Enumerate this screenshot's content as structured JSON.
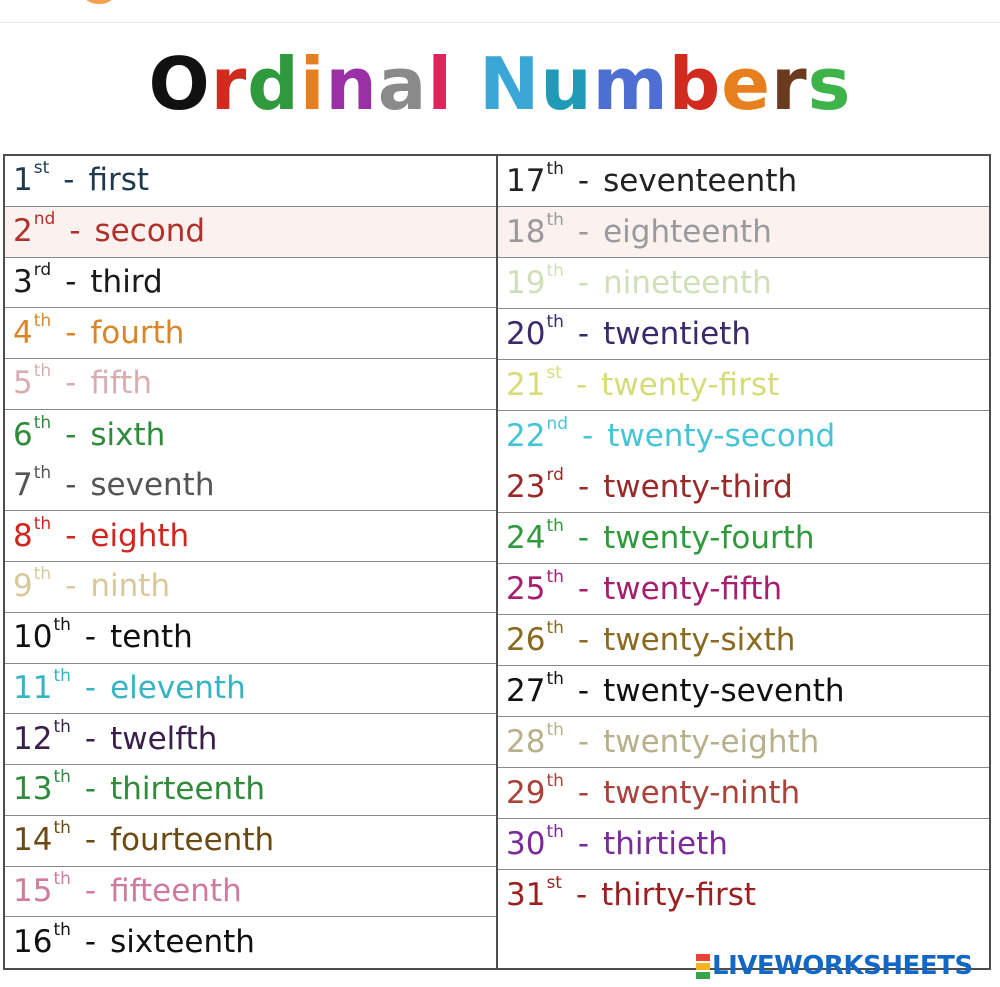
{
  "title": {
    "letters": [
      {
        "char": "O",
        "color": "#111111"
      },
      {
        "char": "r",
        "color": "#d12a1f"
      },
      {
        "char": "d",
        "color": "#2f9a3c"
      },
      {
        "char": "i",
        "color": "#e87f1e"
      },
      {
        "char": "n",
        "color": "#9b2fa6"
      },
      {
        "char": "a",
        "color": "#8a8a8a"
      },
      {
        "char": "l",
        "color": "#e0245e"
      },
      {
        "char": " ",
        "color": "#ffffff"
      },
      {
        "char": "N",
        "color": "#3aa7d6"
      },
      {
        "char": "u",
        "color": "#1f9bb8"
      },
      {
        "char": "m",
        "color": "#4c6fd1"
      },
      {
        "char": "b",
        "color": "#d12a1f"
      },
      {
        "char": "e",
        "color": "#e87f1e"
      },
      {
        "char": "r",
        "color": "#6b3b1f"
      },
      {
        "char": "s",
        "color": "#3db34a"
      }
    ]
  },
  "table": {
    "left": [
      {
        "num": "1",
        "suffix": "st",
        "word": "first",
        "color": "#1f3a4d"
      },
      {
        "num": "2",
        "suffix": "nd",
        "word": "second",
        "color": "#b0312a"
      },
      {
        "num": "3",
        "suffix": "rd",
        "word": "third",
        "color": "#1a1a1a"
      },
      {
        "num": "4",
        "suffix": "th",
        "word": "fourth",
        "color": "#d9862a"
      },
      {
        "num": "5",
        "suffix": "th",
        "word": "fifth",
        "color": "#d9aeb2"
      },
      {
        "num": "6",
        "suffix": "th",
        "word": "sixth",
        "color": "#2f8a3a"
      },
      {
        "num": "7",
        "suffix": "th",
        "word": "seventh",
        "color": "#555555"
      },
      {
        "num": "8",
        "suffix": "th",
        "word": "eighth",
        "color": "#d1261f"
      },
      {
        "num": "9",
        "suffix": "th",
        "word": "ninth",
        "color": "#d8c89a"
      },
      {
        "num": "10",
        "suffix": "th",
        "word": "tenth",
        "color": "#111111"
      },
      {
        "num": "11",
        "suffix": "th",
        "word": "eleventh",
        "color": "#36b3c4"
      },
      {
        "num": "12",
        "suffix": "th",
        "word": "twelfth",
        "color": "#3a1f4d"
      },
      {
        "num": "13",
        "suffix": "th",
        "word": "thirteenth",
        "color": "#2f8a3a"
      },
      {
        "num": "14",
        "suffix": "th",
        "word": "fourteenth",
        "color": "#6b4a12"
      },
      {
        "num": "15",
        "suffix": "th",
        "word": "fifteenth",
        "color": "#d07aa0"
      },
      {
        "num": "16",
        "suffix": "th",
        "word": "sixteenth",
        "color": "#111111"
      }
    ],
    "right": [
      {
        "num": "17",
        "suffix": "th",
        "word": "seventeenth",
        "color": "#222222"
      },
      {
        "num": "18",
        "suffix": "th",
        "word": "eighteenth",
        "color": "#9a9a9a"
      },
      {
        "num": "19",
        "suffix": "th",
        "word": "nineteenth",
        "color": "#cfe0b8"
      },
      {
        "num": "20",
        "suffix": "th",
        "word": "twentieth",
        "color": "#3a2a6b"
      },
      {
        "num": "21",
        "suffix": "st",
        "word": "twenty-first",
        "color": "#d6dc7a"
      },
      {
        "num": "22",
        "suffix": "nd",
        "word": "twenty-second",
        "color": "#46c4d6"
      },
      {
        "num": "23",
        "suffix": "rd",
        "word": "twenty-third",
        "color": "#9a2a2a"
      },
      {
        "num": "24",
        "suffix": "th",
        "word": "twenty-fourth",
        "color": "#2f9a3c"
      },
      {
        "num": "25",
        "suffix": "th",
        "word": "twenty-fifth",
        "color": "#a61f6e"
      },
      {
        "num": "26",
        "suffix": "th",
        "word": "twenty-sixth",
        "color": "#8a6a1f"
      },
      {
        "num": "27",
        "suffix": "th",
        "word": "twenty-seventh",
        "color": "#111111"
      },
      {
        "num": "28",
        "suffix": "th",
        "word": "twenty-eighth",
        "color": "#b7b08a"
      },
      {
        "num": "29",
        "suffix": "th",
        "word": "twenty-ninth",
        "color": "#a8423a"
      },
      {
        "num": "30",
        "suffix": "th",
        "word": "thirtieth",
        "color": "#7a2a9a"
      },
      {
        "num": "31",
        "suffix": "st",
        "word": "thirty-first",
        "color": "#9a1f1f"
      }
    ]
  },
  "watermark": {
    "text": "LIVEWORKSHEETS",
    "color": "#1268c4",
    "mark_colors": [
      "#e8423a",
      "#f2b51f",
      "#3aa34a"
    ]
  }
}
